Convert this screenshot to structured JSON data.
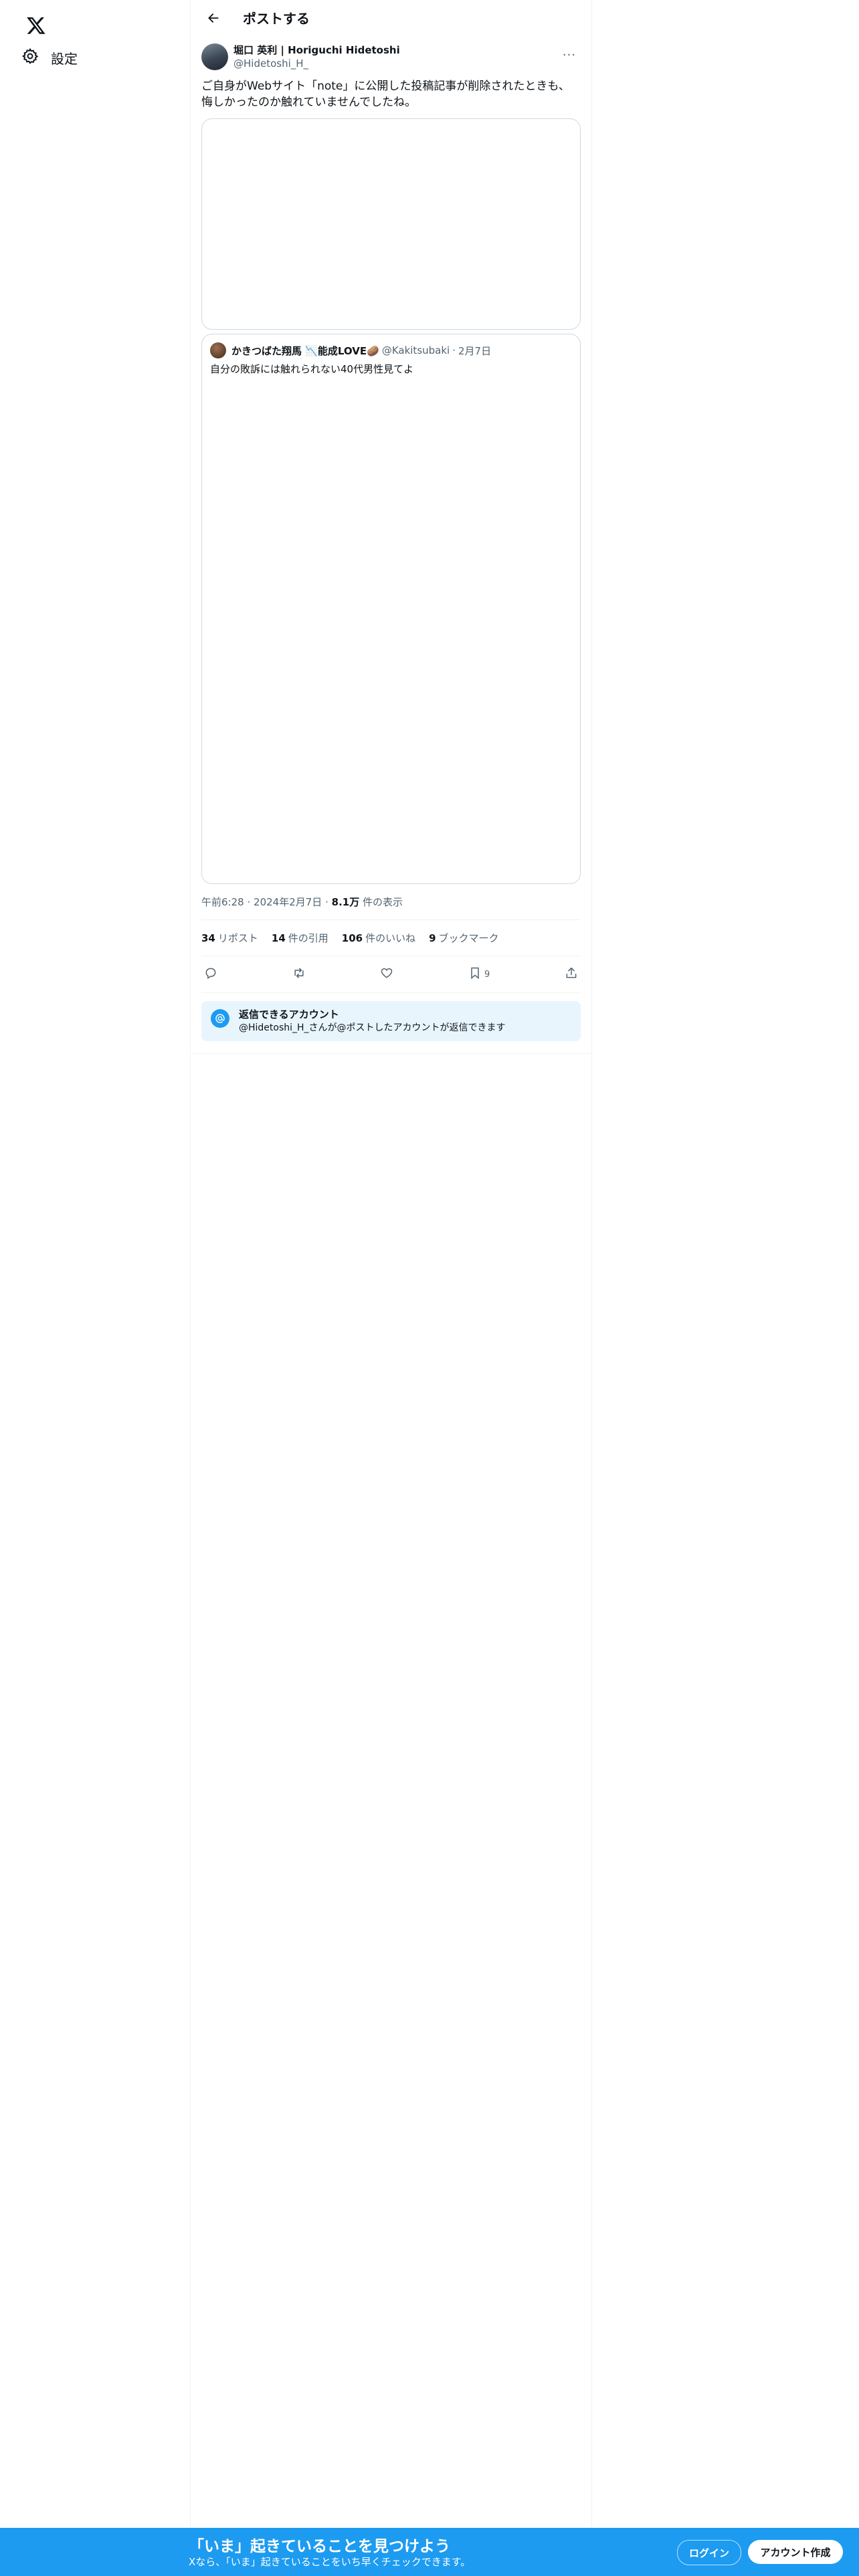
{
  "nav": {
    "logo_label": "X",
    "settings_label": "設定"
  },
  "header": {
    "title": "ポストする"
  },
  "post": {
    "display_name": "堀口 英利 | Horiguchi Hidetoshi",
    "handle": "@Hidetoshi_H_",
    "more_label": "···",
    "text": "ご自身がWebサイト「note」に公開した投稿記事が削除されたときも、悔しかったのか触れていませんでしたね。",
    "quote": {
      "display_name": "かきつばた翔馬 📉能成LOVE🥔",
      "handle": "@Kakitsubaki",
      "separator": "·",
      "date": "2月7日",
      "text": "自分の敗訴には触れられない40代男性見てよ"
    },
    "time": "午前6:28",
    "sep": "·",
    "date": "2024年2月7日",
    "views_count": "8.1万",
    "views_label": "件の表示",
    "stats": {
      "reposts_count": "34",
      "reposts_label": "リポスト",
      "quotes_count": "14",
      "quotes_label": "件の引用",
      "likes_count": "106",
      "likes_label": "件のいいね",
      "bookmarks_count": "9",
      "bookmarks_label": "ブックマーク"
    },
    "actions": {
      "bookmark_count": "9"
    },
    "reply_restriction": {
      "title": "返信できるアカウント",
      "subtitle": "@Hidetoshi_H_さんが@ポストしたアカウントが返信できます"
    }
  },
  "bottom_bar": {
    "title": "「いま」起きていることを見つけよう",
    "subtitle": "Xなら、「いま」起きていることをいち早くチェックできます。",
    "login_label": "ログイン",
    "signup_label": "アカウント作成"
  },
  "colors": {
    "accent": "#1d9bf0",
    "border": "#cfd9de",
    "muted_text": "#536471"
  }
}
